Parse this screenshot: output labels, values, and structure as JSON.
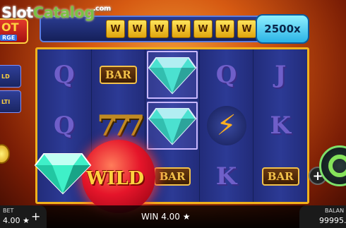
{
  "watermark": {
    "slot": "Slot",
    "catalog": "Catalog",
    "com": ".com"
  },
  "logo": {
    "line1": "OT",
    "line2": "RGE"
  },
  "track": {
    "cells": [
      "W",
      "W",
      "W",
      "W",
      "W",
      "W",
      "W"
    ],
    "multiplier": "2500x"
  },
  "side": {
    "btn1": "LD",
    "btn2": "LTI"
  },
  "reels": [
    [
      "Q",
      "Q",
      ""
    ],
    [
      "BAR",
      "777",
      "WILD"
    ],
    [
      "diamond",
      "diamond",
      "BAR"
    ],
    [
      "Q",
      "bolt",
      "K"
    ],
    [
      "J",
      "K",
      "BAR"
    ]
  ],
  "wild": {
    "label": "WILD"
  },
  "bottom": {
    "bet_label": "BET",
    "bet_value": "4.00 ★",
    "plus": "+",
    "win_text": "WIN 4.00 ★",
    "balance_label": "BALAN",
    "balance_value": "99995.0"
  },
  "icons": [
    "plus-icon",
    "spin-icon",
    "coin-icon",
    "lightning-icon",
    "diamond-icon"
  ],
  "colors": {
    "accent": "#f0b21c",
    "reel_bg": "#2c3a95",
    "spin": "#86e35a"
  }
}
